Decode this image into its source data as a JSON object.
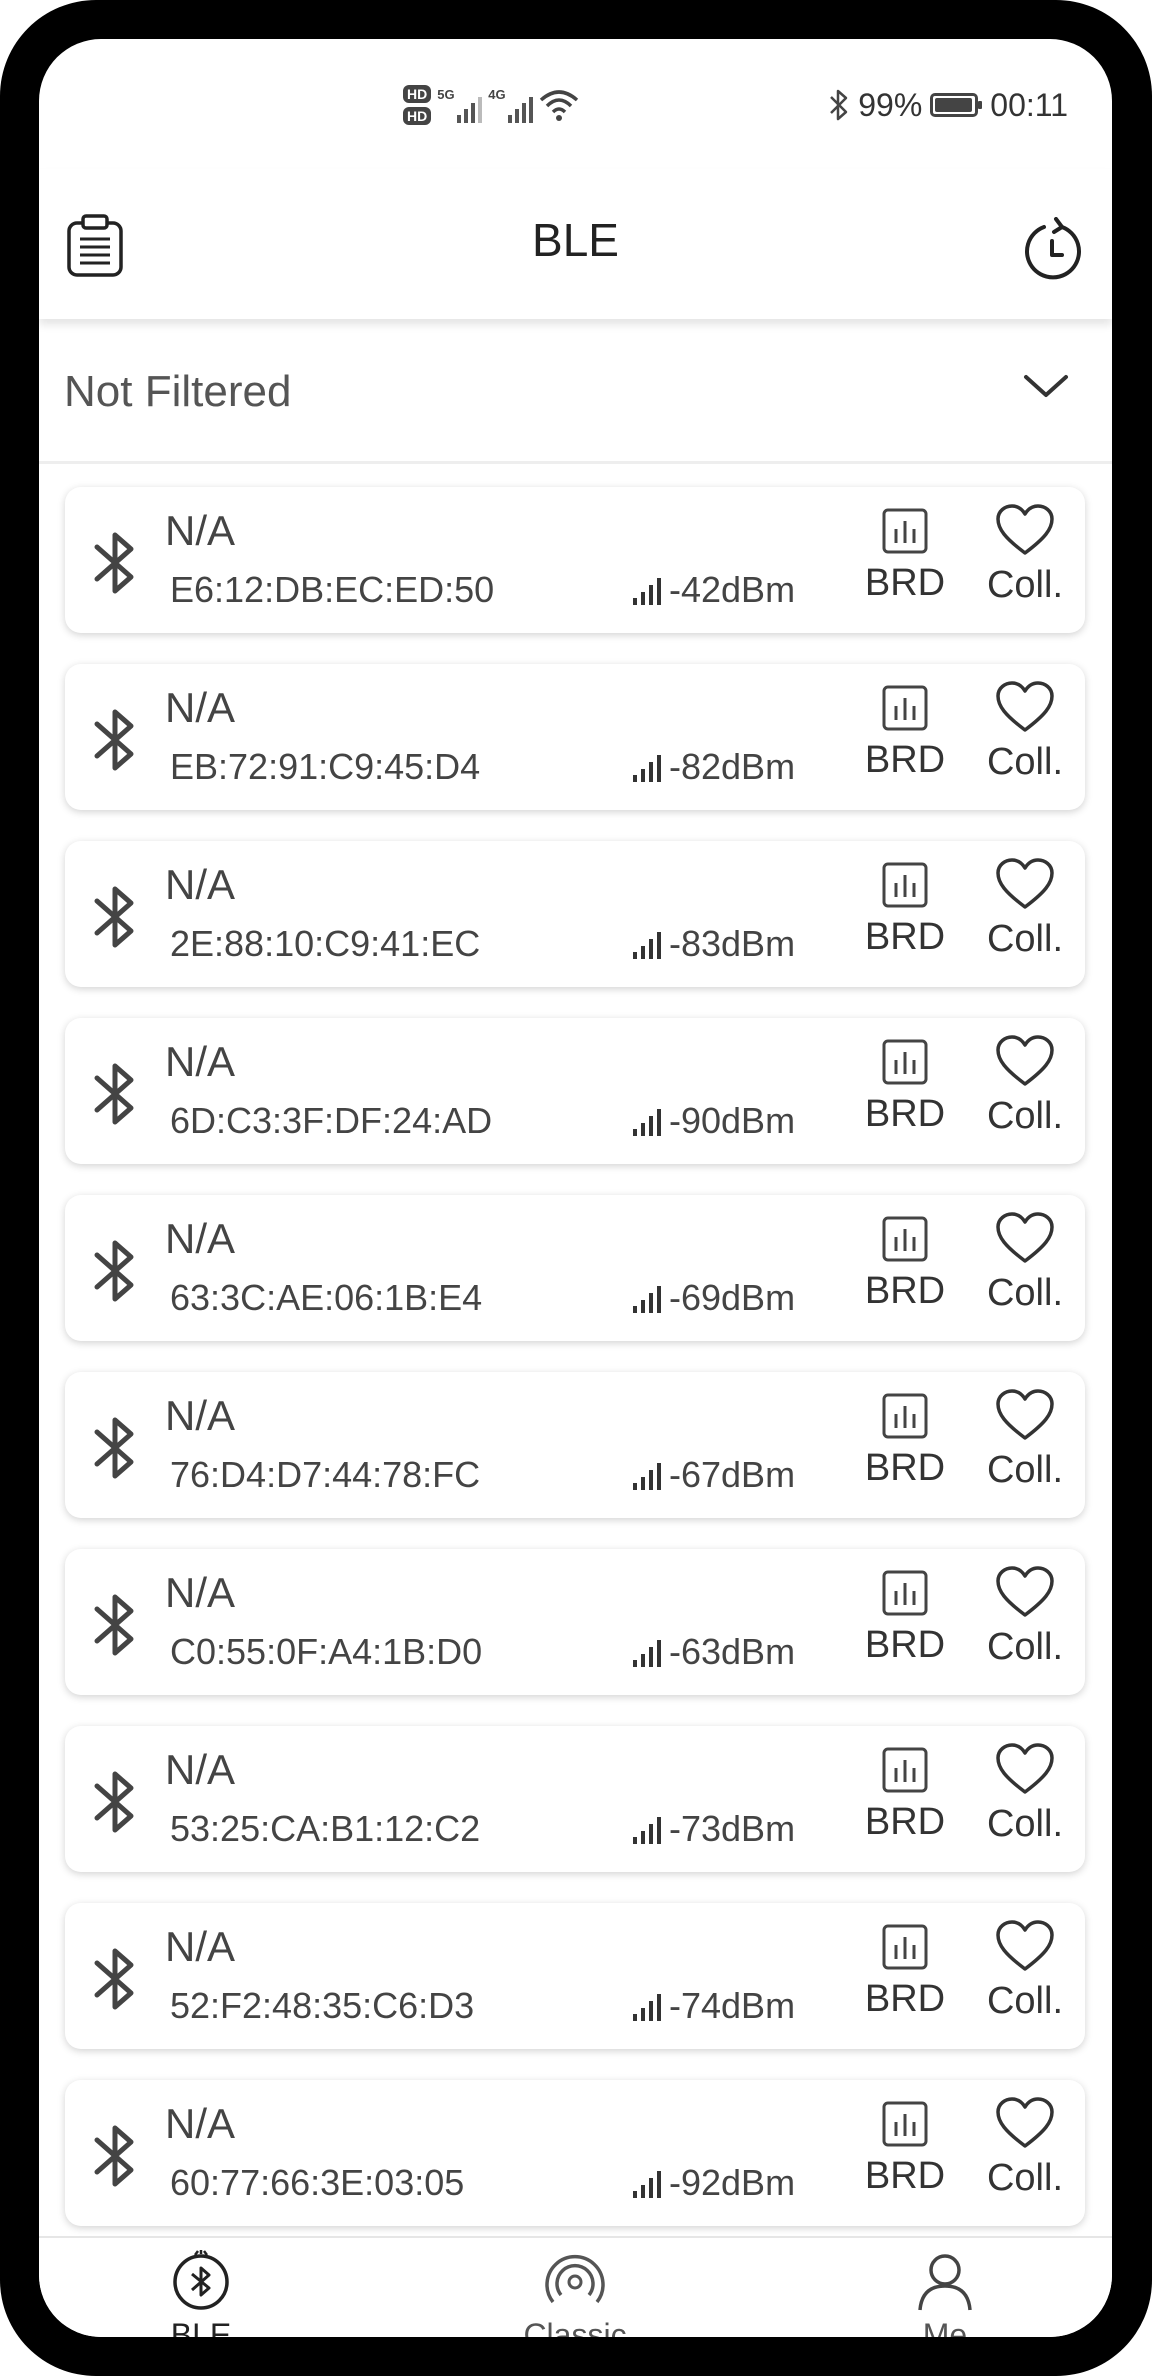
{
  "status_bar": {
    "hd1": "HD",
    "hd2": "HD",
    "net1": "5G",
    "net2": "4G",
    "battery_percent": "99%",
    "time": "00:11",
    "icons": [
      "hd-icon",
      "signal-5g-icon",
      "signal-4g-icon",
      "wifi-icon",
      "bluetooth-icon",
      "battery-icon"
    ]
  },
  "header": {
    "title": "BLE",
    "left_icon": "clipboard-icon",
    "right_icon": "history-icon"
  },
  "filter": {
    "label": "Not Filtered",
    "icon": "chevron-down-icon"
  },
  "devices": [
    {
      "name": "N/A",
      "mac": "E6:12:DB:EC:ED:50",
      "rssi": "-42dBm",
      "brd": "BRD",
      "coll": "Coll."
    },
    {
      "name": "N/A",
      "mac": "EB:72:91:C9:45:D4",
      "rssi": "-82dBm",
      "brd": "BRD",
      "coll": "Coll."
    },
    {
      "name": "N/A",
      "mac": "2E:88:10:C9:41:EC",
      "rssi": "-83dBm",
      "brd": "BRD",
      "coll": "Coll."
    },
    {
      "name": "N/A",
      "mac": "6D:C3:3F:DF:24:AD",
      "rssi": "-90dBm",
      "brd": "BRD",
      "coll": "Coll."
    },
    {
      "name": "N/A",
      "mac": "63:3C:AE:06:1B:E4",
      "rssi": "-69dBm",
      "brd": "BRD",
      "coll": "Coll."
    },
    {
      "name": "N/A",
      "mac": "76:D4:D7:44:78:FC",
      "rssi": "-67dBm",
      "brd": "BRD",
      "coll": "Coll."
    },
    {
      "name": "N/A",
      "mac": "C0:55:0F:A4:1B:D0",
      "rssi": "-63dBm",
      "brd": "BRD",
      "coll": "Coll."
    },
    {
      "name": "N/A",
      "mac": "53:25:CA:B1:12:C2",
      "rssi": "-73dBm",
      "brd": "BRD",
      "coll": "Coll."
    },
    {
      "name": "N/A",
      "mac": "52:F2:48:35:C6:D3",
      "rssi": "-74dBm",
      "brd": "BRD",
      "coll": "Coll."
    },
    {
      "name": "N/A",
      "mac": "60:77:66:3E:03:05",
      "rssi": "-92dBm",
      "brd": "BRD",
      "coll": "Coll."
    }
  ],
  "bottom_nav": {
    "items": [
      {
        "label": "BLE",
        "icon": "ble-scan-icon",
        "active": true
      },
      {
        "label": "Classic",
        "icon": "classic-signal-icon",
        "active": false
      },
      {
        "label": "Me",
        "icon": "person-icon",
        "active": false
      }
    ]
  }
}
